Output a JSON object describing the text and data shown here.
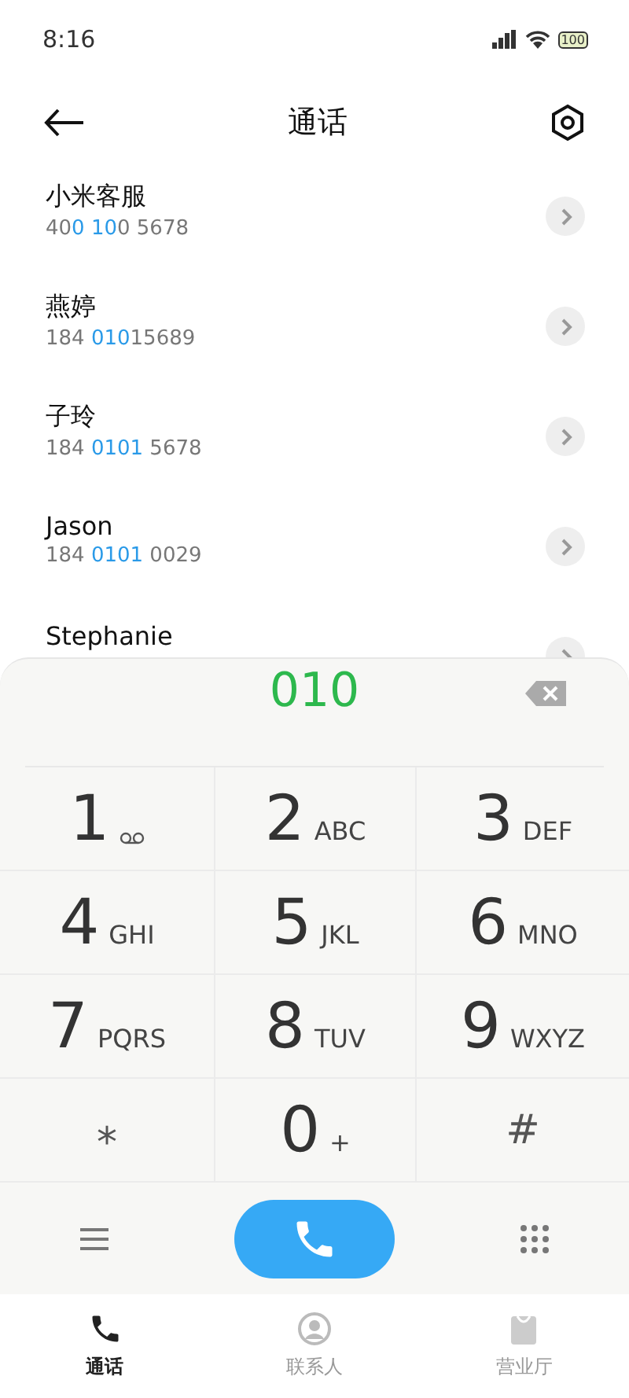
{
  "status_bar": {
    "time": "8:16",
    "battery": "100"
  },
  "header": {
    "title": "通话"
  },
  "contacts": [
    {
      "name": "小米客服",
      "number": [
        {
          "text": "40",
          "highlight": false
        },
        {
          "text": "0 10",
          "highlight": true
        },
        {
          "text": "0 5678",
          "highlight": false
        }
      ]
    },
    {
      "name": "燕婷",
      "number": [
        {
          "text": "184 ",
          "highlight": false
        },
        {
          "text": "010",
          "highlight": true
        },
        {
          "text": "15689",
          "highlight": false
        }
      ]
    },
    {
      "name": "子玲",
      "number": [
        {
          "text": "184 ",
          "highlight": false
        },
        {
          "text": "0101",
          "highlight": true
        },
        {
          "text": " 5678",
          "highlight": false
        }
      ]
    },
    {
      "name": "Jason",
      "number": [
        {
          "text": "184 ",
          "highlight": false
        },
        {
          "text": "0101",
          "highlight": true
        },
        {
          "text": " 0029",
          "highlight": false
        }
      ]
    },
    {
      "name": "Stephanie"
    }
  ],
  "dialer": {
    "input": "010",
    "keys": [
      {
        "kind": "voicemail",
        "digit": "1"
      },
      {
        "kind": "digit",
        "digit": "2",
        "letters": "ABC"
      },
      {
        "kind": "digit",
        "digit": "3",
        "letters": "DEF"
      },
      {
        "kind": "digit",
        "digit": "4",
        "letters": "GHI"
      },
      {
        "kind": "digit",
        "digit": "5",
        "letters": "JKL"
      },
      {
        "kind": "digit",
        "digit": "6",
        "letters": "MNO"
      },
      {
        "kind": "digit",
        "digit": "7",
        "letters": "PQRS"
      },
      {
        "kind": "digit",
        "digit": "8",
        "letters": "TUV"
      },
      {
        "kind": "digit",
        "digit": "9",
        "letters": "WXYZ"
      },
      {
        "kind": "symbol",
        "digit": "⁎"
      },
      {
        "kind": "digit",
        "digit": "0",
        "letters": "+"
      },
      {
        "kind": "symbol",
        "digit": "#"
      }
    ]
  },
  "tabs": [
    {
      "label": "通话",
      "selected": true
    },
    {
      "label": "联系人",
      "selected": false
    },
    {
      "label": "营业厅",
      "selected": false
    }
  ]
}
